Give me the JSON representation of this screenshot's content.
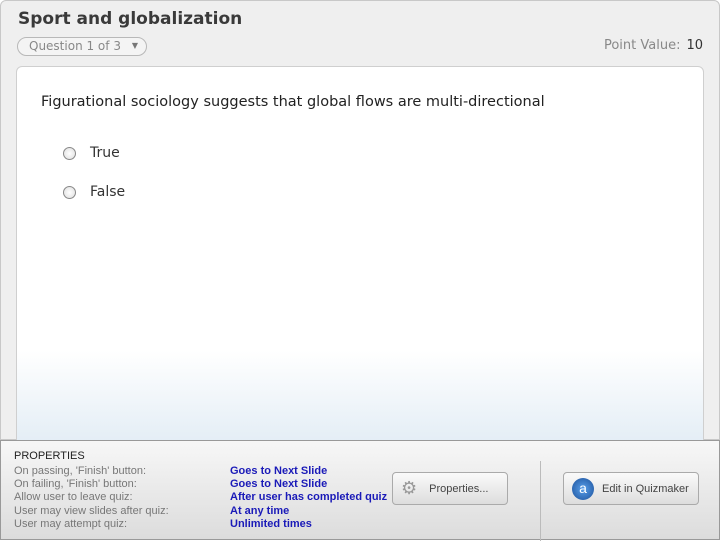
{
  "header": {
    "title": "Sport and globalization",
    "question_selector": "Question 1 of 3",
    "point_value_label": "Point Value:",
    "point_value": "10"
  },
  "question": {
    "text": "Figurational sociology suggests that global flows are multi-directional",
    "options": [
      "True",
      "False"
    ]
  },
  "properties": {
    "heading": "PROPERTIES",
    "rows": [
      {
        "label": "On passing, 'Finish' button:",
        "value": "Goes to Next Slide"
      },
      {
        "label": "On failing, 'Finish' button:",
        "value": "Goes to Next Slide"
      },
      {
        "label": "Allow user to leave quiz:",
        "value": "After user has completed quiz"
      },
      {
        "label": "User may view slides after quiz:",
        "value": "At any time"
      },
      {
        "label": "User may attempt quiz:",
        "value": "Unlimited times"
      }
    ],
    "properties_button": "Properties...",
    "edit_button": "Edit in Quizmaker"
  }
}
